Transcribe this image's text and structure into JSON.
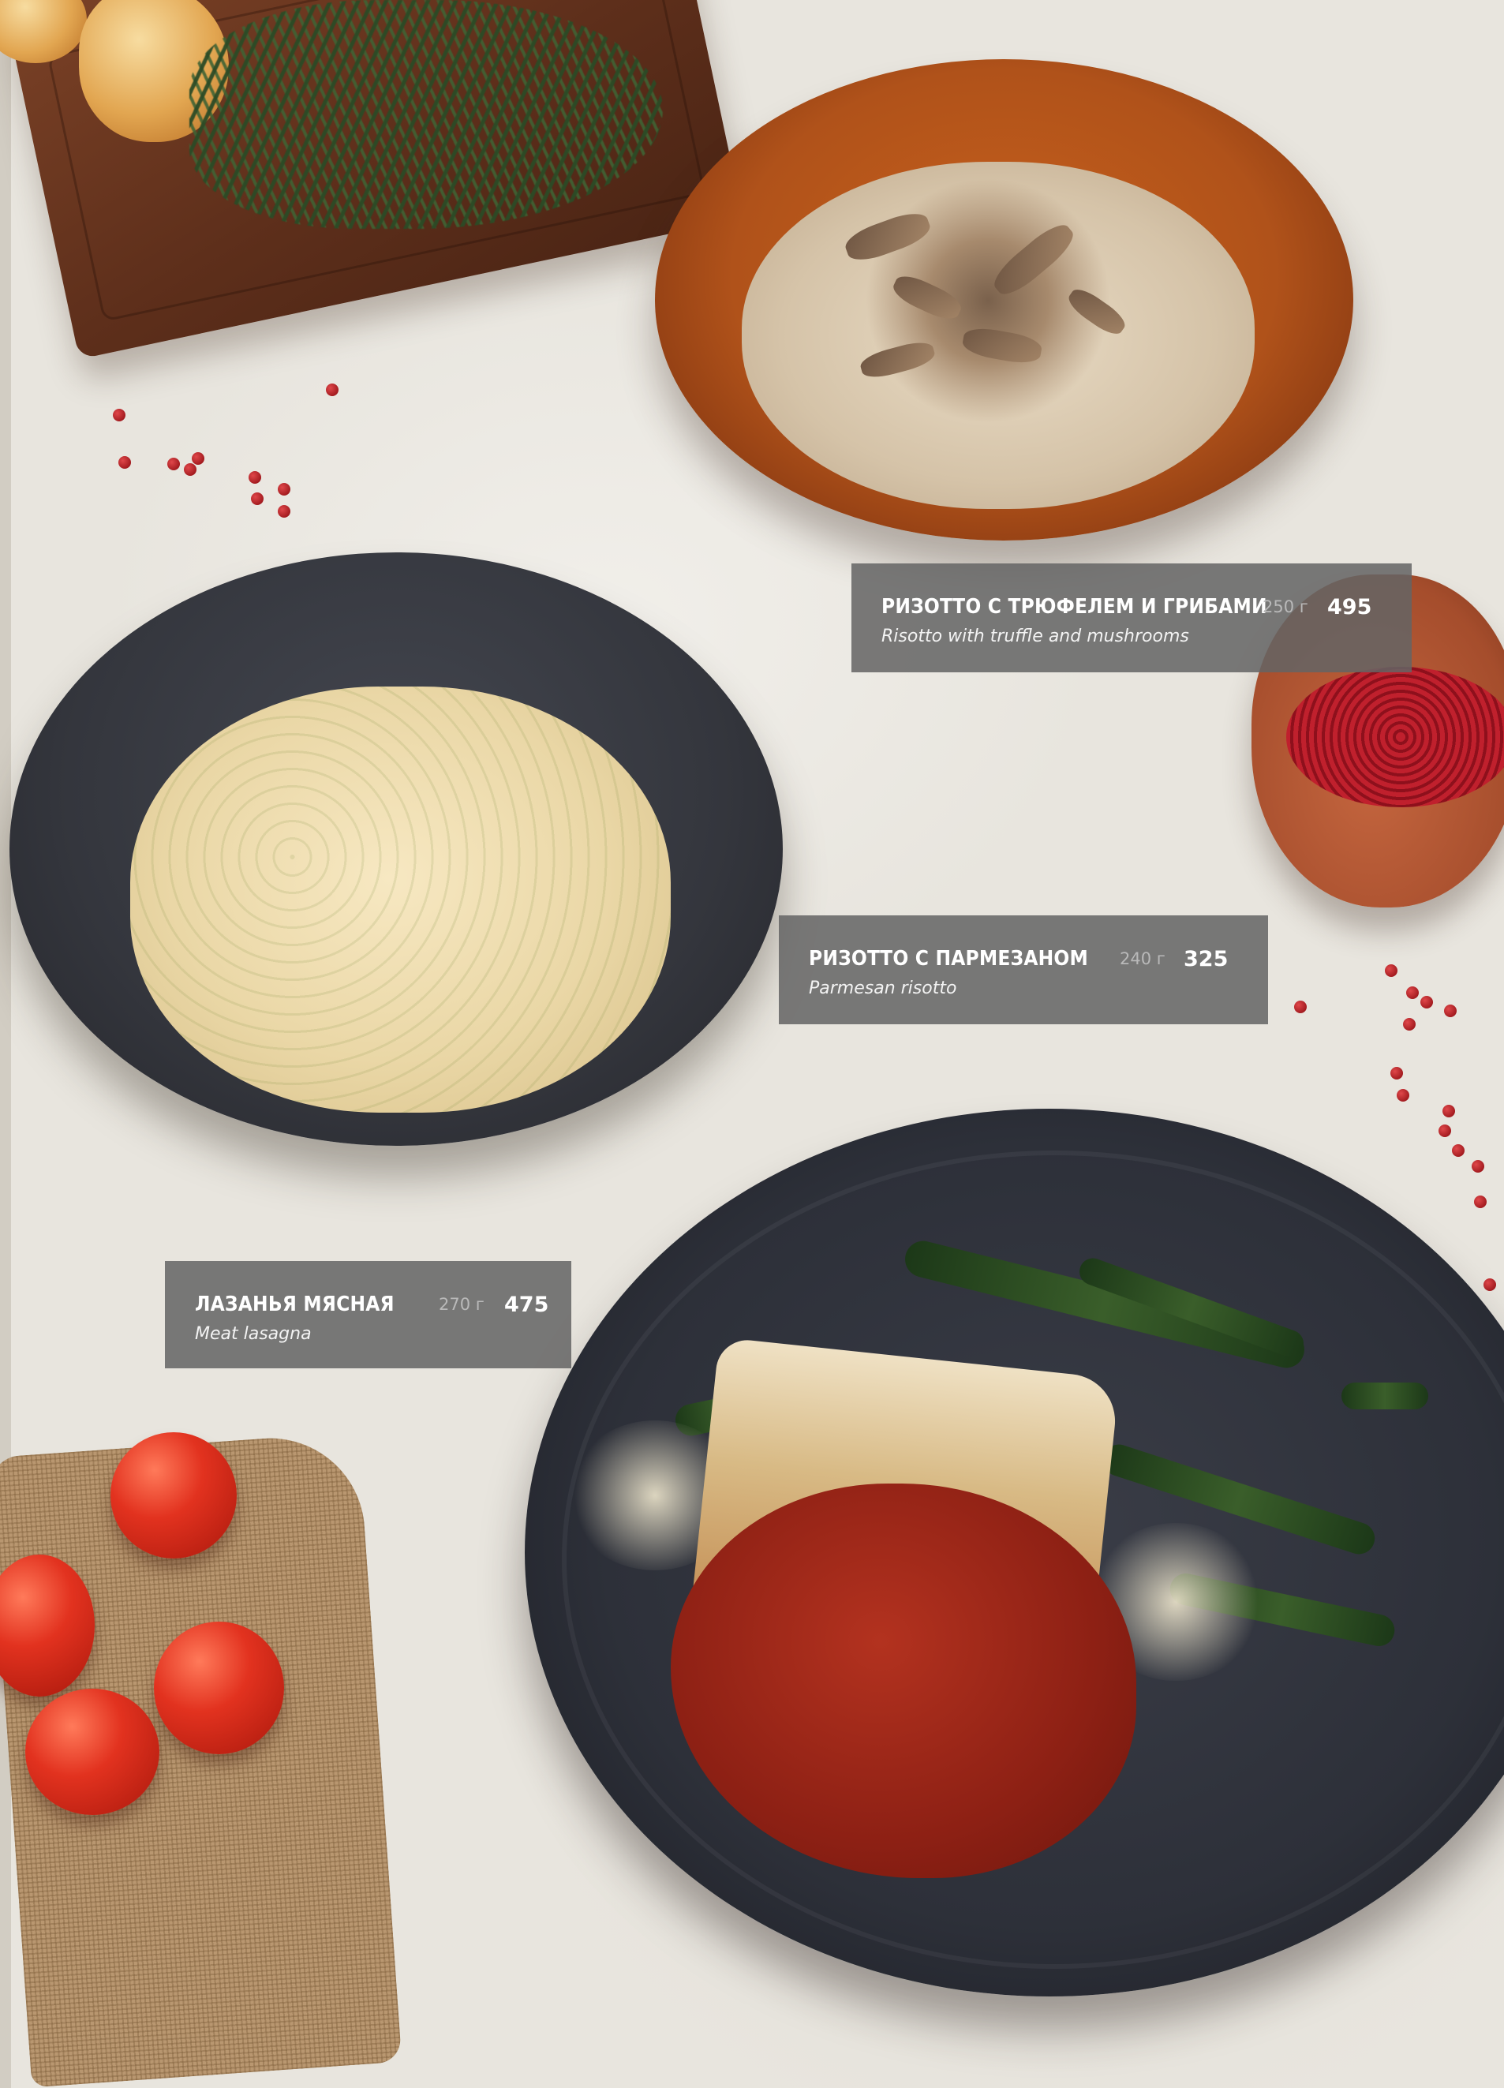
{
  "menu_items": [
    {
      "name_ru": "РИЗОТТО С ТРЮФЕЛЕМ И ГРИБАМИ",
      "name_en": "Risotto with truffle and mushrooms",
      "weight": "250 г",
      "price": "495"
    },
    {
      "name_ru": "РИЗОТТО С ПАРМЕЗАНОМ",
      "name_en": "Parmesan risotto",
      "weight": "240 г",
      "price": "325"
    },
    {
      "name_ru": "ЛАЗАНЬЯ МЯСНАЯ",
      "name_en": "Meat lasagna",
      "weight": "270 г",
      "price": "475"
    }
  ],
  "colors": {
    "background": "#e8e5de",
    "label_background": "#646464",
    "label_text": "#ffffff",
    "weight_text": "#b9b9b9"
  }
}
